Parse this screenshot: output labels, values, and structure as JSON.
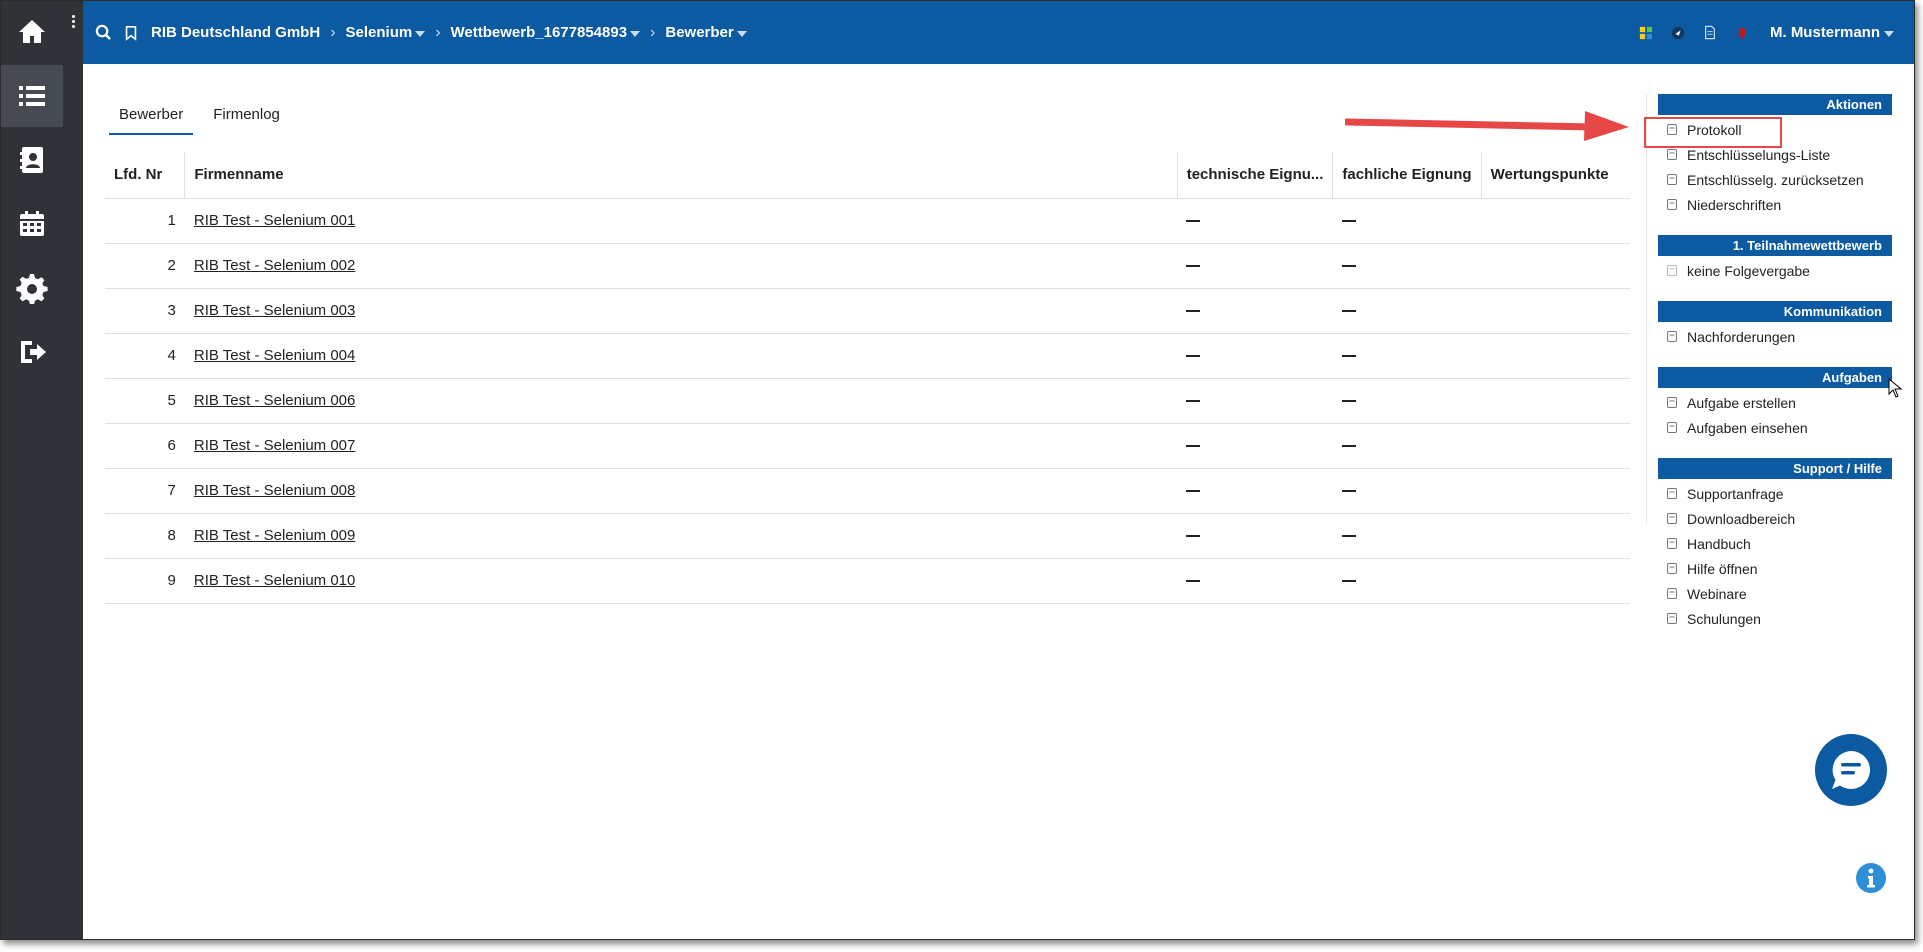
{
  "header": {
    "breadcrumbs": [
      {
        "label": "RIB Deutschland GmbH",
        "caret": false
      },
      {
        "label": "Selenium",
        "caret": true
      },
      {
        "label": "Wettbewerb_1677854893",
        "caret": true
      },
      {
        "label": "Bewerber",
        "caret": true
      }
    ],
    "user": "M. Mustermann"
  },
  "tabs": [
    {
      "label": "Bewerber",
      "active": true
    },
    {
      "label": "Firmenlog",
      "active": false
    }
  ],
  "table": {
    "columns": [
      "Lfd. Nr",
      "Firmenname",
      "technische Eignu...",
      "fachliche Eignung",
      "Wertungspunkte"
    ],
    "rows": [
      {
        "nr": "1",
        "name": "RIB Test - Selenium 001"
      },
      {
        "nr": "2",
        "name": "RIB Test - Selenium 002"
      },
      {
        "nr": "3",
        "name": "RIB Test - Selenium 003"
      },
      {
        "nr": "4",
        "name": "RIB Test - Selenium 004"
      },
      {
        "nr": "5",
        "name": "RIB Test - Selenium 006"
      },
      {
        "nr": "6",
        "name": "RIB Test - Selenium 007"
      },
      {
        "nr": "7",
        "name": "RIB Test - Selenium 008"
      },
      {
        "nr": "8",
        "name": "RIB Test - Selenium 009"
      },
      {
        "nr": "9",
        "name": "RIB Test - Selenium 010"
      }
    ]
  },
  "panel": [
    {
      "title": "Aktionen",
      "items": [
        "Protokoll",
        "Entschlüsselungs-Liste",
        "Entschlüsselg. zurücksetzen",
        "Niederschriften"
      ]
    },
    {
      "title": "1. Teilnahmewettbewerb",
      "items": [
        "keine Folgevergabe"
      ]
    },
    {
      "title": "Kommunikation",
      "items": [
        "Nachforderungen"
      ]
    },
    {
      "title": "Aufgaben",
      "items": [
        "Aufgabe erstellen",
        "Aufgaben einsehen"
      ]
    },
    {
      "title": "Support / Hilfe",
      "items": [
        "Supportanfrage",
        "Downloadbereich",
        "Handbuch",
        "Hilfe öffnen",
        "Webinare",
        "Schulungen"
      ]
    }
  ],
  "icons": {
    "sidebar": [
      "home-icon",
      "list-icon",
      "contacts-icon",
      "calendar-icon",
      "gear-icon",
      "logout-icon"
    ],
    "header": [
      "search-icon",
      "bookmark-icon",
      "apps-icon",
      "notes-icon",
      "document-icon",
      "bell-icon"
    ],
    "floating": [
      "chat-icon",
      "info-icon"
    ]
  },
  "colors": {
    "header": "#0b5aa2",
    "sidebar": "#2f3337",
    "highlight": "#e64848"
  }
}
